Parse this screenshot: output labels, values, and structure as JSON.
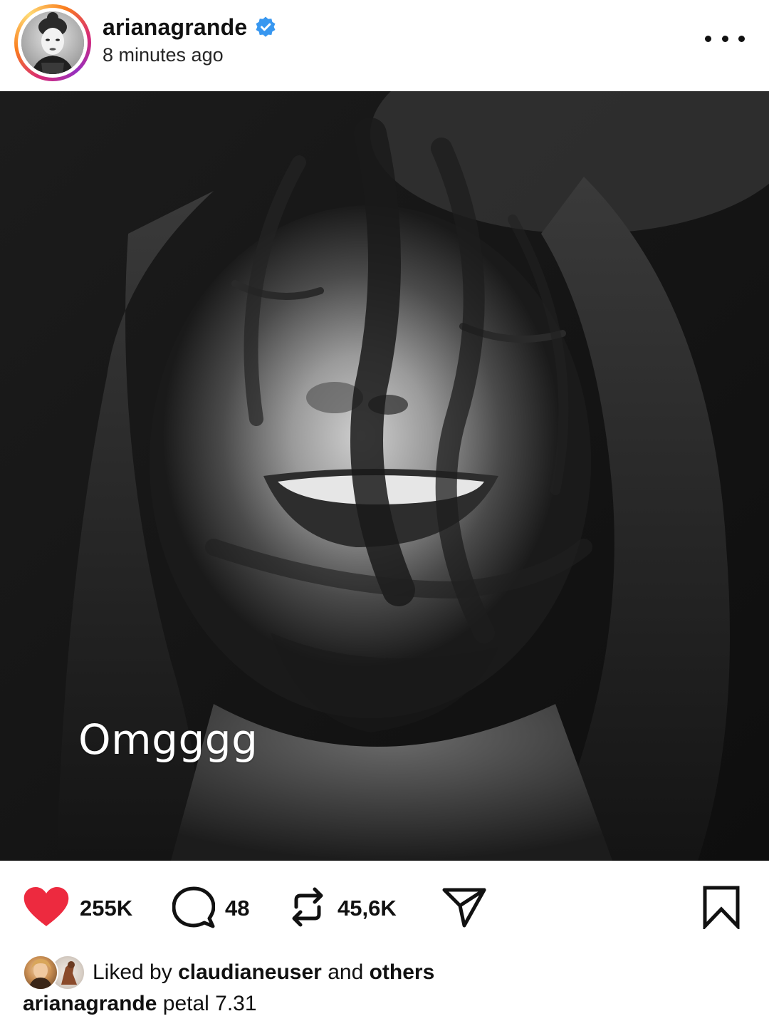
{
  "post": {
    "username": "arianagrande",
    "verified": true,
    "timestamp": "8 minutes ago",
    "more_label": "more options",
    "overlay_text": "Omgggg"
  },
  "actions": {
    "likes": "255K",
    "comments": "48",
    "reposts": "45,6K",
    "liked": true
  },
  "liked_by": {
    "prefix": "Liked by",
    "user": "claudianeuser",
    "conj": "and",
    "others": "others"
  },
  "caption": {
    "username": "arianagrande",
    "text": "petal 7.31"
  },
  "colors": {
    "heart": "#ED2A3F",
    "verified": "#3897F0",
    "text": "#111111"
  },
  "icons": [
    "verified-badge-icon",
    "more-icon",
    "heart-icon",
    "comment-icon",
    "repost-icon",
    "share-icon",
    "bookmark-icon"
  ]
}
